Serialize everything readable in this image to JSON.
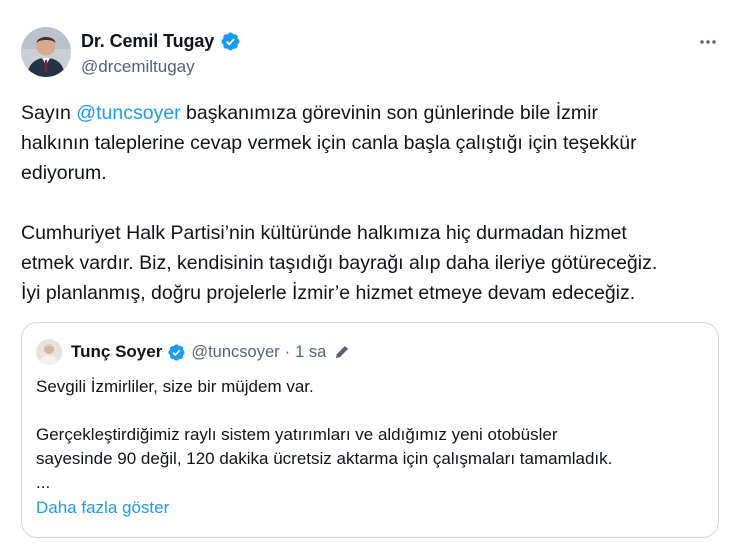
{
  "author": {
    "display_name": "Dr. Cemil Tugay",
    "handle": "@drcemiltugay"
  },
  "tweet": {
    "line1_prefix": "Sayın ",
    "line1_mention": "@tuncsoyer",
    "line1_suffix": " başkanımıza görevinin son günlerinde bile İzmir",
    "line2": "halkının taleplerine cevap vermek için canla başla çalıştığı için teşekkür",
    "line3": "ediyorum.",
    "line4": "Cumhuriyet Halk Partisi’nin kültüründe halkımıza hiç durmadan hizmet",
    "line5": "etmek vardır. Biz, kendisinin taşıdığı bayrağı alıp daha ileriye götüreceğiz.",
    "line6": "İyi planlanmış, doğru projelerle İzmir’e hizmet etmeye devam edeceğiz."
  },
  "quote": {
    "display_name": "Tunç Soyer",
    "handle": "@tuncsoyer",
    "separator": "·",
    "time": "1 sa",
    "line1": "Sevgili İzmirliler, size bir müjdem var.",
    "line2": "Gerçekleştirdiğimiz raylı sistem yatırımları ve aldığımız yeni otobüsler",
    "line3": "sayesinde 90 değil, 120 dakika ücretsiz aktarma için çalışmaları tamamladık.",
    "line4": "...",
    "show_more": "Daha fazla göster"
  },
  "colors": {
    "accent": "#1d9bf0",
    "text_primary": "#0f1419",
    "text_secondary": "#536471",
    "border": "#cfd9de"
  },
  "icons": {
    "verified": "verified-badge-icon",
    "more": "more-horizontal-icon",
    "edited": "edit-pencil-icon"
  }
}
